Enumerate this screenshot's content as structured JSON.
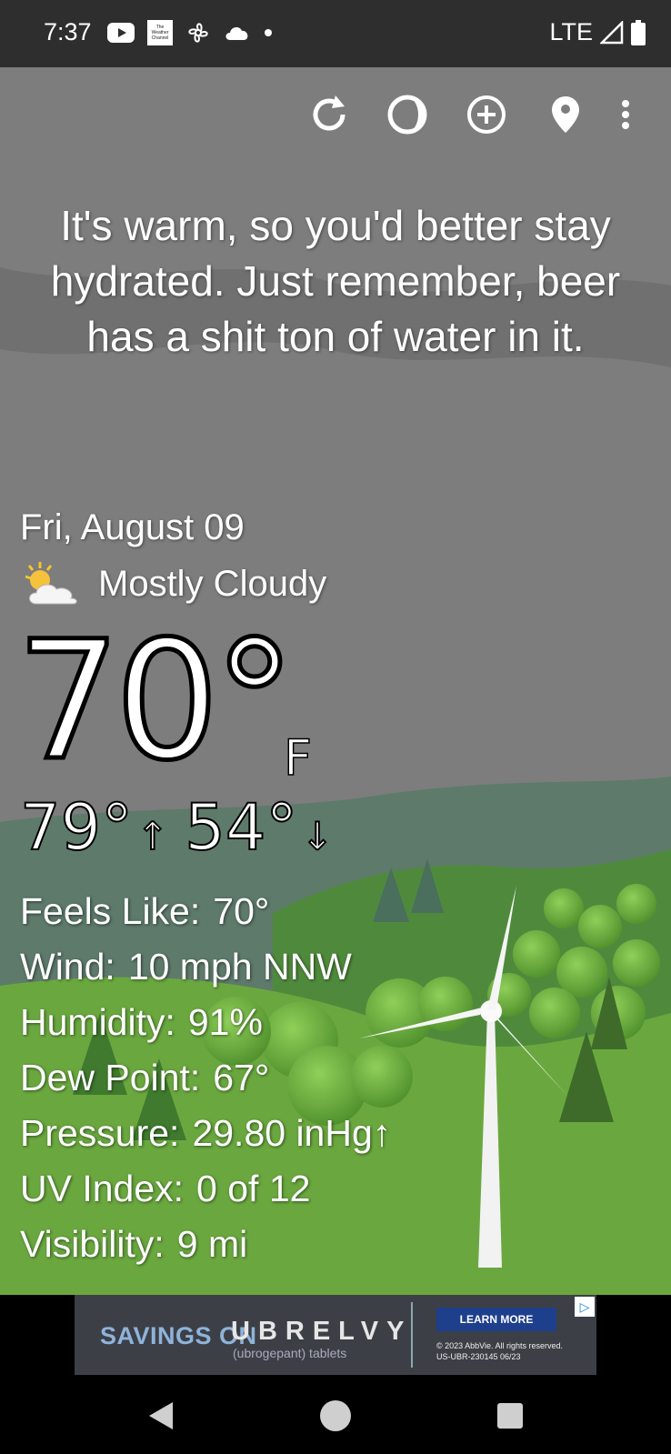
{
  "status_bar": {
    "time": "7:37",
    "network": "LTE",
    "icons": [
      "youtube-icon",
      "weather-channel-icon",
      "fan-icon",
      "cloud-icon",
      "dot-icon"
    ],
    "weather_channel_text": "The Weather Channel"
  },
  "toolbar": {
    "buttons": [
      "refresh-icon",
      "moon-phase-icon",
      "add-location-icon",
      "location-pin-icon",
      "more-vert-icon"
    ]
  },
  "snark": "It's warm, so you'd better stay hydrated. Just remember, beer has a shit ton of water in it.",
  "date": "Fri, August 09",
  "condition": {
    "label": "Mostly Cloudy",
    "icon": "partly-cloudy-icon"
  },
  "temperature": {
    "value": "70°",
    "unit": "F"
  },
  "hi_lo": {
    "high": "79°",
    "high_arrow": "↑",
    "low": "54°",
    "low_arrow": "↓"
  },
  "details": [
    {
      "label": "Feels Like:",
      "value": "70°"
    },
    {
      "label": "Wind:",
      "value": "10 mph NNW"
    },
    {
      "label": "Humidity:",
      "value": "91%"
    },
    {
      "label": "Dew Point:",
      "value": "67°"
    },
    {
      "label": "Pressure:",
      "value": "29.80 inHg↑"
    },
    {
      "label": "UV Index:",
      "value": "0 of 12"
    },
    {
      "label": "Visibility:",
      "value": "9 mi"
    }
  ],
  "ad": {
    "savings": "SAVINGS ON",
    "brand": "UBRELVY",
    "sub": "(ubrogepant) tablets",
    "learn_more": "LEARN MORE",
    "legal_line1": "© 2023 AbbVie. All rights reserved.",
    "legal_line2": "US-UBR-230145 06/23"
  },
  "nav": [
    "back-icon",
    "home-icon",
    "recents-icon"
  ]
}
